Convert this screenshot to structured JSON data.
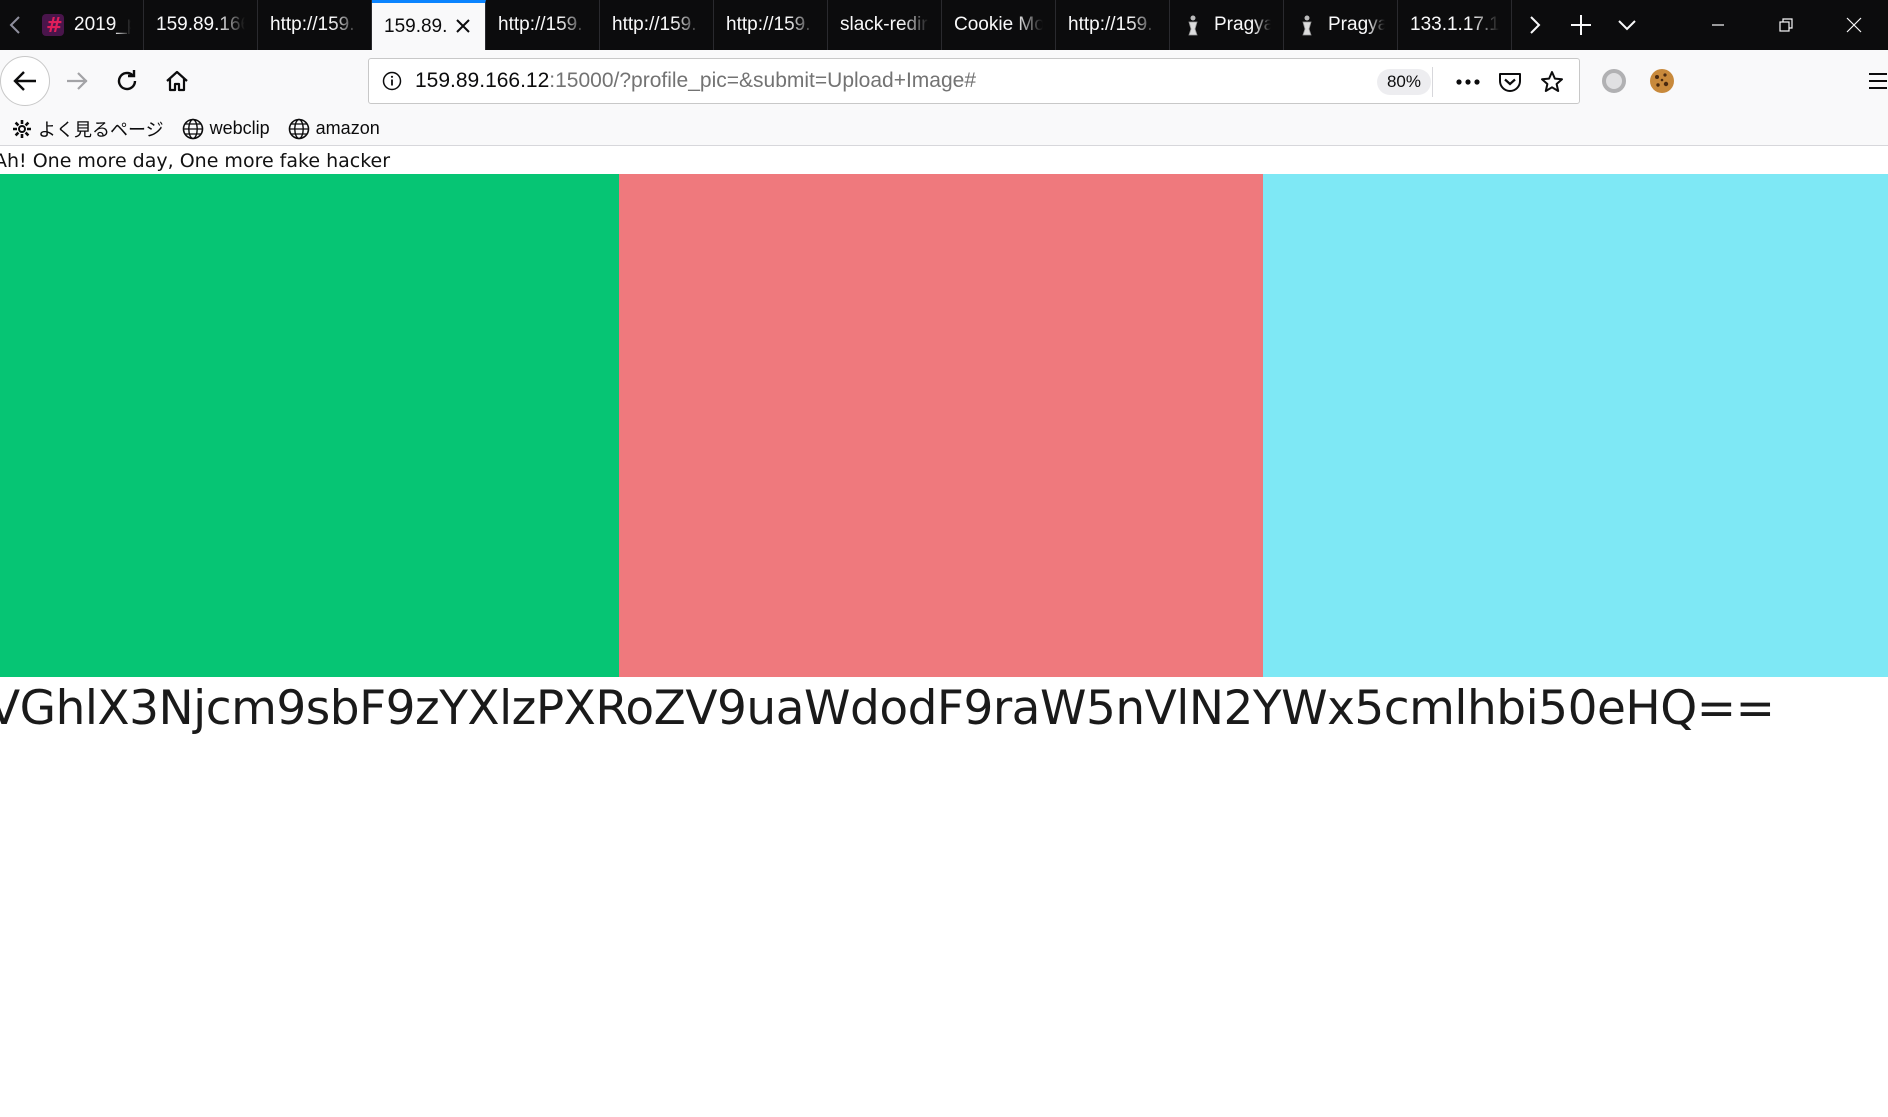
{
  "browser": {
    "tabs": [
      {
        "title": "2019_p",
        "favicon": "slack-icon",
        "selected": false
      },
      {
        "title": "159.89.166",
        "favicon": "",
        "selected": false
      },
      {
        "title": "http://159.",
        "favicon": "",
        "selected": false
      },
      {
        "title": "159.89.",
        "favicon": "",
        "selected": true
      },
      {
        "title": "http://159.",
        "favicon": "",
        "selected": false
      },
      {
        "title": "http://159.",
        "favicon": "",
        "selected": false
      },
      {
        "title": "http://159.",
        "favicon": "",
        "selected": false
      },
      {
        "title": "slack-redir",
        "favicon": "",
        "selected": false
      },
      {
        "title": "Cookie Mo",
        "favicon": "",
        "selected": false
      },
      {
        "title": "http://159.",
        "favicon": "",
        "selected": false
      },
      {
        "title": "Pragya",
        "favicon": "pragyan-icon",
        "selected": false
      },
      {
        "title": "Pragya",
        "favicon": "pragyan-icon",
        "selected": false
      },
      {
        "title": "133.1.17.1",
        "favicon": "",
        "selected": false
      }
    ],
    "url": {
      "host": "159.89.166.12",
      "rest": ":15000/?profile_pic=&submit=Upload+Image#"
    },
    "zoom": "80%",
    "bookmarks": [
      {
        "label": "よく見るページ",
        "icon": "gear-icon"
      },
      {
        "label": "webclip",
        "icon": "globe-icon"
      },
      {
        "label": "amazon",
        "icon": "globe-icon"
      }
    ]
  },
  "page": {
    "message": "Ah! One more day, One more fake hacker",
    "blocks": [
      {
        "color": "#06c574"
      },
      {
        "color": "#ef797d"
      },
      {
        "color": "#7ee8f5"
      }
    ],
    "encoded_text": "VGhlX3Njcm9sbF9zYXlzPXRoZV9uaWdodF9raW5nVlN2YWx5cmlhbi50eHQ=="
  }
}
